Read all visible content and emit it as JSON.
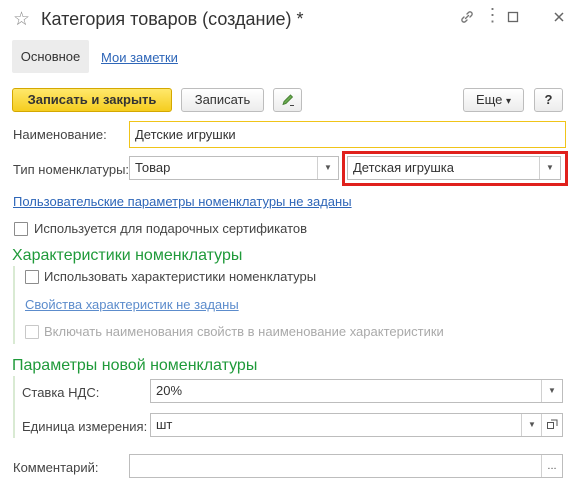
{
  "window": {
    "title": "Категория товаров (создание) *",
    "icons": [
      "star-icon",
      "link-icon",
      "more-icon",
      "minimize-icon",
      "close-icon"
    ]
  },
  "tabs": {
    "main": "Основное",
    "notes": "Мои заметки"
  },
  "toolbar": {
    "save_close": "Записать и закрыть",
    "save": "Записать",
    "edit_icon": "pencil-icon",
    "more": "Еще",
    "more_arrow": "▾",
    "help": "?"
  },
  "form": {
    "name_label": "Наименование:",
    "name_value": "Детские игрушки",
    "type_label": "Тип номенклатуры:",
    "type_value": "Товар",
    "kind_value": "Детская игрушка",
    "user_params_link": "Пользовательские параметры номенклатуры не заданы",
    "gift_cert_label": "Используется для подарочных сертификатов"
  },
  "characteristics": {
    "heading": "Характеристики номенклатуры",
    "use_label": "Использовать характеристики номенклатуры",
    "props_link": "Свойства характеристик не заданы",
    "include_names_label": "Включать наименования свойств в наименование характеристики"
  },
  "new_params": {
    "heading": "Параметры новой номенклатуры",
    "vat_label": "Ставка НДС:",
    "vat_value": "20%",
    "unit_label": "Единица измерения:",
    "unit_value": "шт"
  },
  "comment": {
    "label": "Комментарий:",
    "value": "",
    "button": "..."
  },
  "colors": {
    "highlight": "#e0201c",
    "accent_green": "#1f9a3a",
    "link": "#2e66b8",
    "primary_button": "#f5cd1f",
    "name_field_border": "#f0c419"
  }
}
